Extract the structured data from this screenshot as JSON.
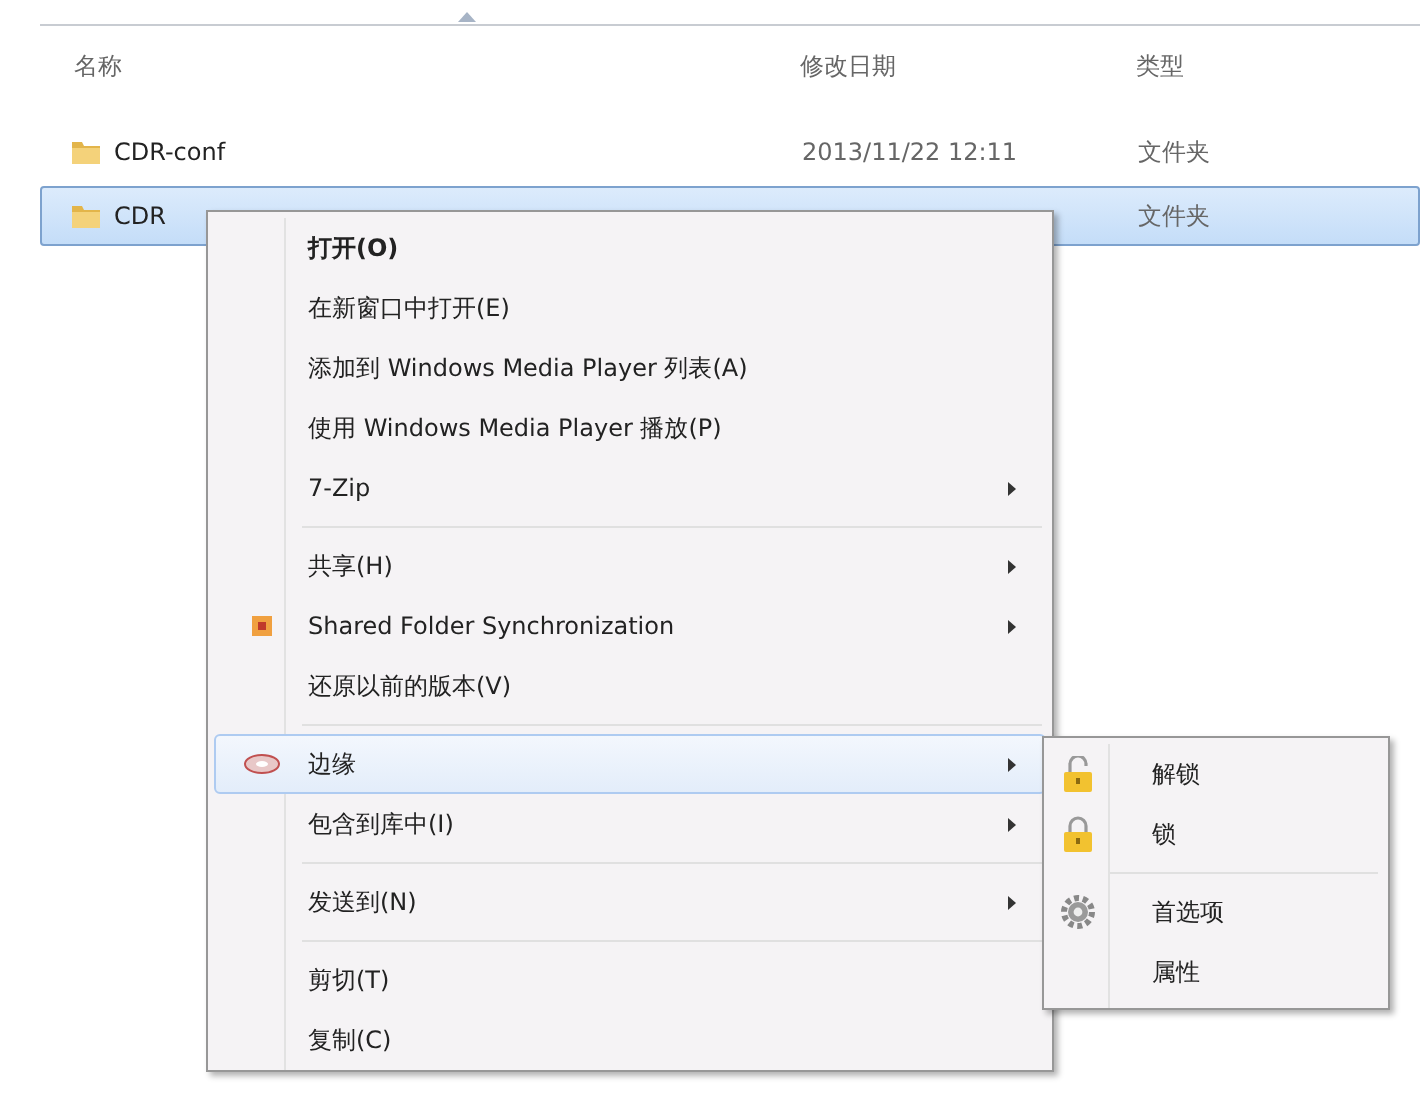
{
  "columns": [
    {
      "label": "名称"
    },
    {
      "label": "修改日期"
    },
    {
      "label": "类型"
    }
  ],
  "files": [
    {
      "name": "CDR-conf",
      "modified": "2013/11/22 12:11",
      "type": "文件夹",
      "selected": false
    },
    {
      "name": "CDR",
      "type": "文件夹",
      "selected": true
    }
  ],
  "context_menu": [
    {
      "kind": "plain",
      "label": "打开(O)",
      "bold": true,
      "submenu": false,
      "highlighted": false
    },
    {
      "kind": "plain",
      "label": "在新窗口中打开(E)",
      "bold": false,
      "submenu": false,
      "highlighted": false
    },
    {
      "kind": "plain",
      "label": "添加到 Windows Media Player 列表(A)",
      "bold": false,
      "submenu": false,
      "highlighted": false
    },
    {
      "kind": "plain",
      "label": "使用 Windows Media Player 播放(P)",
      "bold": false,
      "submenu": false,
      "highlighted": false
    },
    {
      "kind": "plain",
      "label": "7-Zip",
      "bold": false,
      "submenu": true,
      "highlighted": false
    },
    {
      "kind": "separator"
    },
    {
      "kind": "plain",
      "label": "共享(H)",
      "bold": false,
      "submenu": true,
      "highlighted": false
    },
    {
      "kind": "sync",
      "label": "Shared Folder Synchronization",
      "bold": false,
      "submenu": true,
      "highlighted": false
    },
    {
      "kind": "plain",
      "label": "还原以前的版本(V)",
      "bold": false,
      "submenu": false,
      "highlighted": false
    },
    {
      "kind": "separator"
    },
    {
      "kind": "edge",
      "label": "边缘",
      "bold": false,
      "submenu": true,
      "highlighted": true
    },
    {
      "kind": "plain",
      "label": "包含到库中(I)",
      "bold": false,
      "submenu": true,
      "highlighted": false
    },
    {
      "kind": "separator"
    },
    {
      "kind": "plain",
      "label": "发送到(N)",
      "bold": false,
      "submenu": true,
      "highlighted": false
    },
    {
      "kind": "separator"
    },
    {
      "kind": "plain",
      "label": "剪切(T)",
      "bold": false,
      "submenu": false,
      "highlighted": false
    },
    {
      "kind": "plain",
      "label": "复制(C)",
      "bold": false,
      "submenu": false,
      "highlighted": false
    }
  ],
  "submenu": [
    {
      "kind": "unlock",
      "label": "解锁"
    },
    {
      "kind": "lock",
      "label": "锁"
    },
    {
      "kind": "separator"
    },
    {
      "kind": "settings",
      "label": "首选项"
    },
    {
      "kind": "plain",
      "label": "属性"
    }
  ]
}
